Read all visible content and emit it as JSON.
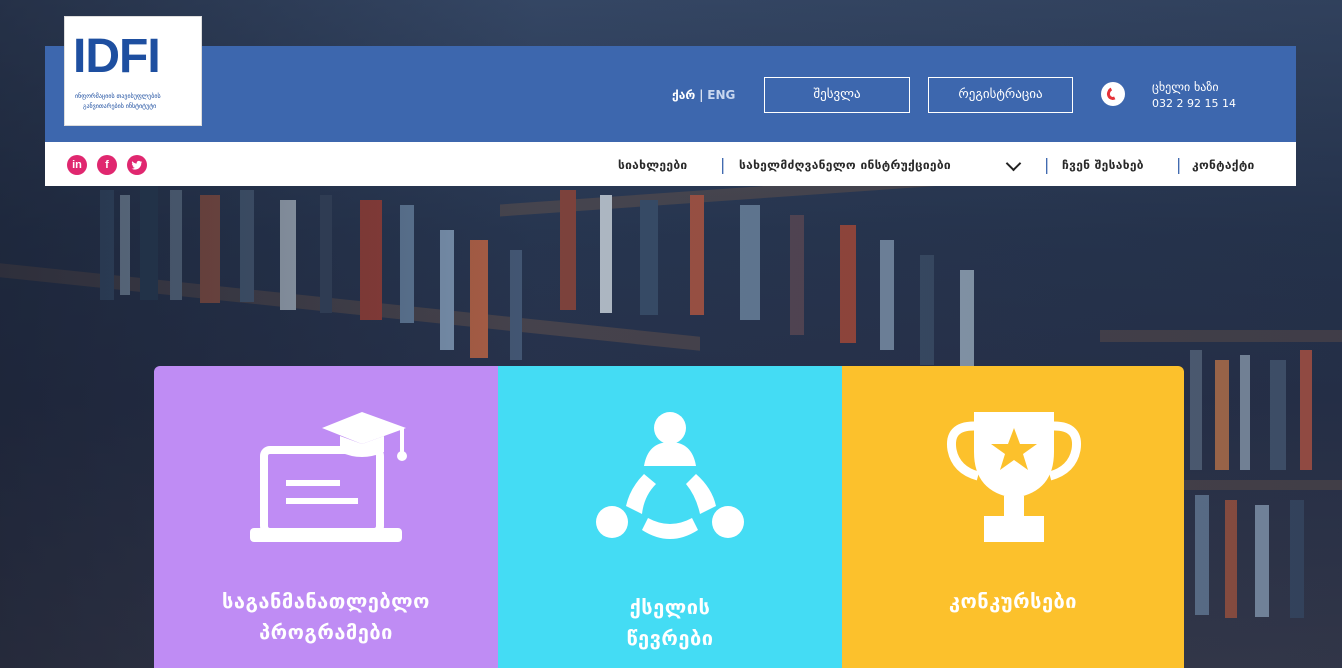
{
  "logo": {
    "text": "IDFI",
    "line1": "ინფორმაციის თავისუფლების",
    "line2": "განვითარების ინსტიტუტი"
  },
  "header": {
    "lang_ka": "ქარ",
    "lang_sep": "|",
    "lang_en": "ENG",
    "login_label": "შესვლა",
    "register_label": "რეგისტრაცია",
    "hotline_label": "ცხელი ხაზი",
    "hotline_number": "032 2 92 15 14"
  },
  "social": {
    "linkedin": "in",
    "facebook": "f",
    "twitter": "t"
  },
  "nav": {
    "items": [
      {
        "label": "სიახლეები"
      },
      {
        "label": "სახელმძღვანელო ინსტრუქციები"
      },
      {
        "label": "ჩვენ შესახებ"
      },
      {
        "label": "კონტაქტი"
      }
    ],
    "separator": "|"
  },
  "tiles": [
    {
      "line1": "საგანმანათლებლო",
      "line2": "პროგრამები",
      "color": "#bf8cf4",
      "icon": "laptop-graduation-icon"
    },
    {
      "line1": "ქსელის",
      "line2": "წევრები",
      "color": "#44dcf4",
      "icon": "network-members-icon"
    },
    {
      "line1": "კონკურსები",
      "line2": "",
      "color": "#fcc12c",
      "icon": "trophy-icon"
    }
  ],
  "colors": {
    "header_blue": "#3d67ae",
    "social_pink": "#e0276f",
    "hotline_red": "#e53238"
  }
}
